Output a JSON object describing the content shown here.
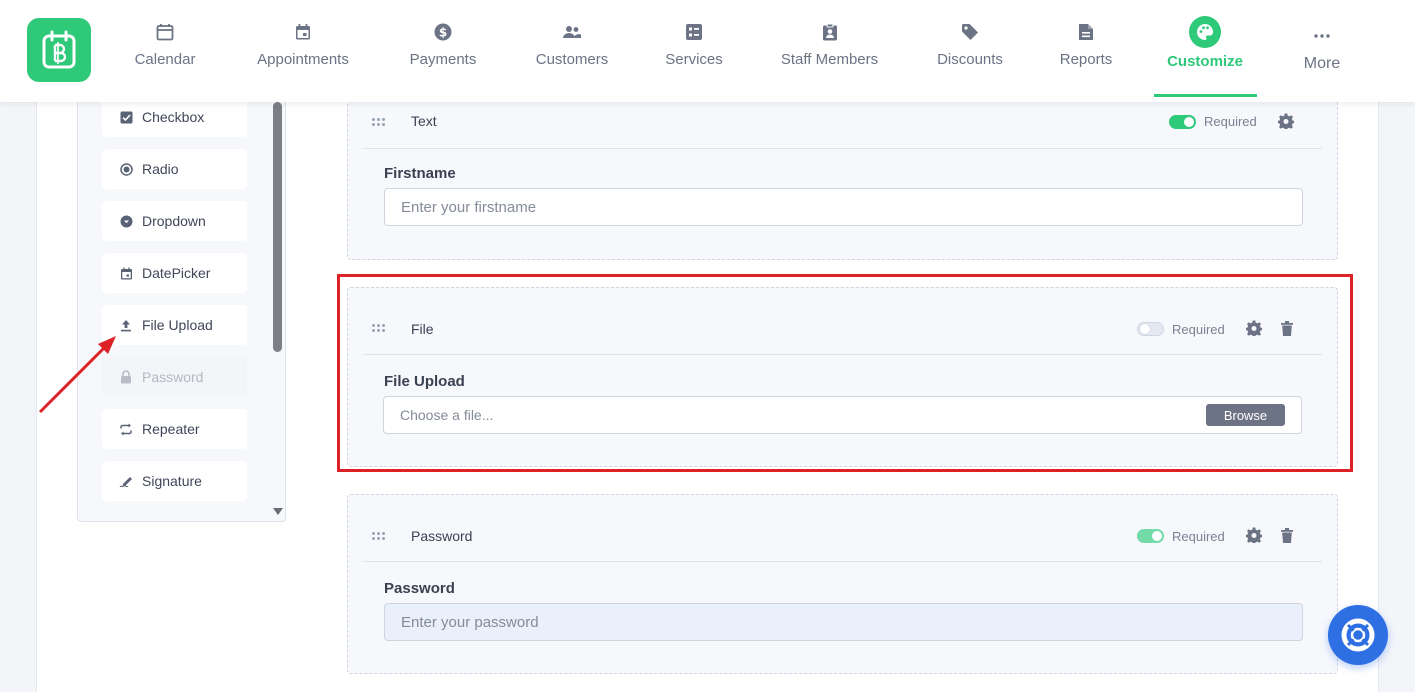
{
  "colors": {
    "brand": "#2fc97a",
    "highlight": "#dd2227",
    "help": "#2f6fe4",
    "browse": "#6c7384"
  },
  "nav": {
    "logo_icon": "app-logo-icon",
    "items": [
      {
        "label": "Calendar",
        "icon": "calendar-icon"
      },
      {
        "label": "Appointments",
        "icon": "appointments-icon"
      },
      {
        "label": "Payments",
        "icon": "dollar-icon"
      },
      {
        "label": "Customers",
        "icon": "users-icon"
      },
      {
        "label": "Services",
        "icon": "services-icon"
      },
      {
        "label": "Staff Members",
        "icon": "staff-badge-icon"
      },
      {
        "label": "Discounts",
        "icon": "tag-icon"
      },
      {
        "label": "Reports",
        "icon": "report-icon"
      },
      {
        "label": "Customize",
        "icon": "palette-icon",
        "active": true
      },
      {
        "label": "More",
        "icon": "more-dots-icon"
      }
    ]
  },
  "palette": {
    "items": [
      {
        "label": "Checkbox",
        "icon": "checkbox-icon"
      },
      {
        "label": "Radio",
        "icon": "radio-icon"
      },
      {
        "label": "Dropdown",
        "icon": "dropdown-icon"
      },
      {
        "label": "DatePicker",
        "icon": "calendar-icon"
      },
      {
        "label": "File Upload",
        "icon": "upload-icon"
      },
      {
        "label": "Password",
        "icon": "lock-icon",
        "disabled": true
      },
      {
        "label": "Repeater",
        "icon": "repeat-icon"
      },
      {
        "label": "Signature",
        "icon": "signature-icon"
      }
    ]
  },
  "cards": {
    "text": {
      "type": "Text",
      "required_label": "Required",
      "required": true,
      "field_label": "Firstname",
      "placeholder": "Enter your firstname"
    },
    "file": {
      "type": "File",
      "required_label": "Required",
      "required": false,
      "field_label": "File Upload",
      "placeholder": "Choose a file...",
      "button": "Browse"
    },
    "password": {
      "type": "Password",
      "required_label": "Required",
      "required": true,
      "field_label": "Password",
      "placeholder": "Enter your password"
    }
  },
  "help": {
    "icon": "lifebuoy-icon"
  }
}
